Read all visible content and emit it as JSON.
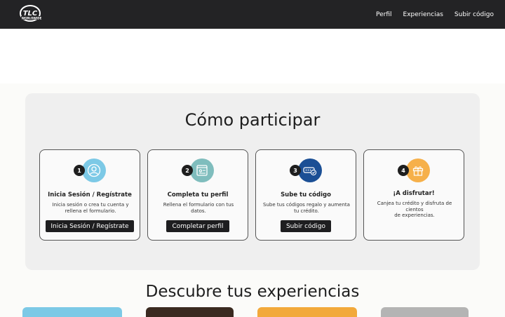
{
  "header": {
    "logo_text": "TLC WORLDWIDE",
    "nav": [
      "Perfil",
      "Experiencias",
      "Subir código"
    ]
  },
  "how": {
    "title": "Cómo participar",
    "steps": [
      {
        "num": "1",
        "title": "Inicia Sesión / Regístrate",
        "text_line1": "Inicia sesión o crea tu cuenta y",
        "text_line2": "rellena el formulario.",
        "button": "Inicia Sesión / Regístrate",
        "icon": "user-icon",
        "color": "#7cc9e6"
      },
      {
        "num": "2",
        "title": "Completa tu perfil",
        "text_line1": "Rellena el formulario con tus datos.",
        "text_line2": "",
        "button": "Completar perfil",
        "icon": "profile-form-icon",
        "color": "#7fbdbd"
      },
      {
        "num": "3",
        "title": "Sube tu código",
        "text_line1": "Sube tus códigos regalo y aumenta",
        "text_line2": "tu crédito.",
        "button": "Subir código",
        "icon": "code-check-icon",
        "color": "#1b4f95"
      },
      {
        "num": "4",
        "title": "¡A disfrutar!",
        "text_line1": "Canjea tu crédito y disfruta de",
        "text_line2": "cientos",
        "text_line3": "de experiencias.",
        "button": "",
        "icon": "gift-icon",
        "color": "#f6b04a"
      }
    ]
  },
  "experiences": {
    "title": "Descubre tus experiencias",
    "card_colors": [
      "#7cc9e6",
      "#3a2a20",
      "#f2a93b",
      "#b4b4b4"
    ]
  }
}
